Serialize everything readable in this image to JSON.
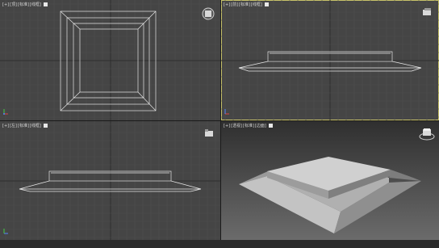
{
  "viewports": [
    {
      "id": "top",
      "label": [
        "[+]",
        "[顶]",
        "[标准]",
        "[线框]"
      ]
    },
    {
      "id": "front",
      "label": [
        "[+]",
        "[前]",
        "[标准]",
        "[线框]"
      ]
    },
    {
      "id": "left",
      "label": [
        "[+]",
        "[左]",
        "[标准]",
        "[线框]"
      ]
    },
    {
      "id": "perspective",
      "label": [
        "[+]",
        "[透视]",
        "[标准]",
        "[边面]"
      ]
    }
  ],
  "colors": {
    "viewport_bg": "#454545",
    "grid_minor": "#4f4f4f",
    "grid_major": "#2e2e2e",
    "wire": "#e6e6e6",
    "active_border": "#c8c26a"
  }
}
